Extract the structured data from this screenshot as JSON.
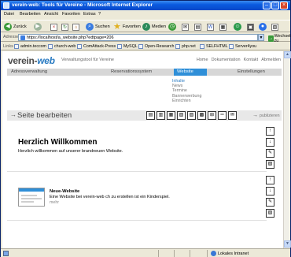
{
  "window": {
    "title": "verein-web: Tools für Vereine - Microsoft Internet Explorer"
  },
  "menu": [
    "Datei",
    "Bearbeiten",
    "Ansicht",
    "Favoriten",
    "Extras",
    "?"
  ],
  "toolbar": {
    "back_label": "Zurück",
    "search_label": "Suchen",
    "favorites_label": "Favoriten",
    "media_label": "Medien"
  },
  "address": {
    "label": "Adresse",
    "url": "https://localhost/a_website.php?edtpage=206",
    "go_label": "Wechseln zu"
  },
  "links": {
    "label": "Links",
    "items": [
      "admin.teccom",
      "church-web",
      "ComAttack-Press",
      "MySQL",
      "Open-Research",
      "php.net",
      "SELFHTML",
      "Server4you"
    ]
  },
  "site": {
    "logo_main": "verein-",
    "logo_accent": "web",
    "tagline": "Verwaltungstool für Vereine",
    "toplinks": [
      "Home",
      "Dokumentation",
      "Kontakt",
      "Abmelden"
    ],
    "nav": [
      "Adressverwaltung",
      "Reservationssystem",
      "Website",
      "Einstellungen"
    ],
    "nav_active_index": 2,
    "subnav": [
      "Inhalte",
      "News",
      "Termine",
      "Bannerwerbung",
      "Einrichten"
    ]
  },
  "editor": {
    "page_title": "Seite bearbeiten",
    "publish_label": "publizieren",
    "block1": {
      "title": "Herzlich Willkommen",
      "text": "Herzlich willkommen auf unserer brandneuen Website."
    },
    "block2": {
      "title": "Neue-Website",
      "text": "Eine Website bei verein-web ch zu erstellen ist ein Kinderspiel.",
      "more": "mehr"
    }
  },
  "status": {
    "zone": "Lokales Intranet"
  },
  "icons": {
    "back": "back-arrow-icon",
    "forward": "forward-arrow-icon",
    "search": "search-icon",
    "favorites": "star-icon"
  }
}
